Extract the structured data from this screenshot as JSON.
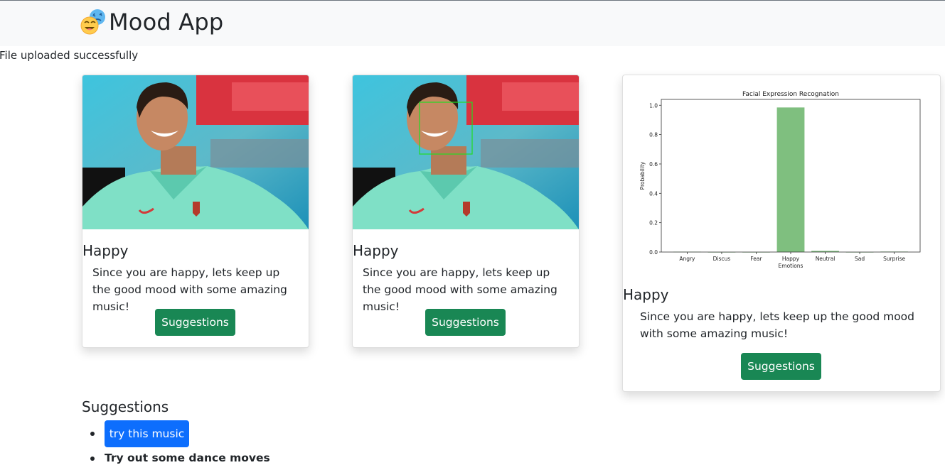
{
  "app": {
    "title": "Mood App"
  },
  "flash": {
    "message": "File uploaded successfully"
  },
  "cards": [
    {
      "title": "Happy",
      "text": "Since you are happy, lets keep up the good mood with some amazing music!",
      "button": "Suggestions"
    },
    {
      "title": "Happy",
      "text": "Since you are happy, lets keep up the good mood with some amazing music!",
      "button": "Suggestions"
    },
    {
      "title": "Happy",
      "text": "Since you are happy, lets keep up the good mood with some amazing music!",
      "button": "Suggestions"
    }
  ],
  "suggestions": {
    "heading": "Suggestions",
    "items": [
      {
        "label": "try this music",
        "type": "button"
      },
      {
        "label": "Try out some dance moves",
        "type": "text"
      }
    ]
  },
  "colors": {
    "success": "#198754",
    "primary": "#0d6efd",
    "bar": "#7fbf7f",
    "face_box": "#22dd22"
  },
  "chart_data": {
    "type": "bar",
    "title": "Facial Expression Recognation",
    "xlabel": "Emotions",
    "ylabel": "Probability",
    "categories": [
      "Angry",
      "Discus",
      "Fear",
      "Happy",
      "Neutral",
      "Sad",
      "Surprise"
    ],
    "values": [
      0.002,
      0.0,
      0.0,
      0.985,
      0.008,
      0.0,
      0.003
    ],
    "ylim": [
      0,
      1.04
    ],
    "yticks": [
      "0.0",
      "0.2",
      "0.4",
      "0.6",
      "0.8",
      "1.0"
    ],
    "grid": false,
    "legend": "none"
  }
}
